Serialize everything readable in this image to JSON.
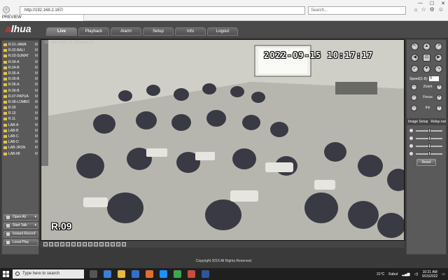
{
  "browser": {
    "url": "http://192.168.2.167/",
    "search_placeholder": "Search...",
    "tab_title": "PREVIEW"
  },
  "app": {
    "logo_prefix": "a",
    "logo_text": "lhua",
    "nav": [
      {
        "label": "Live",
        "active": true
      },
      {
        "label": "Playback",
        "active": false
      },
      {
        "label": "Alarm",
        "active": false
      },
      {
        "label": "Setup",
        "active": false
      },
      {
        "label": "Info",
        "active": false
      },
      {
        "label": "Logout",
        "active": false
      }
    ]
  },
  "cameras": [
    "R.01-JAWA",
    "R.02-BALI",
    "R.03-SUMAT",
    "R.04-A",
    "R.04-B",
    "R.05-A",
    "R.05-B",
    "R.06-A",
    "R.06-B",
    "R.07-PAPUA",
    "R.08-LOMBO",
    "R.09",
    "R.10",
    "R.11",
    "LAB-A",
    "LAB-B",
    "LAB-C",
    "LAB-D",
    "LAB-JRSN",
    "LAB-MI"
  ],
  "camera_marker": "M",
  "controls": {
    "open_all": "Open All",
    "start_talk": "Start Talk",
    "instant_record": "Instant Record",
    "local_play": "Local Play"
  },
  "video": {
    "info": "192.168.2.167_12_957Kbps_M",
    "timestamp": "2022-09-15 10:17:17",
    "label": "R.09"
  },
  "ptz": {
    "speed_label": "Speed(1-8):",
    "speed_value": "5",
    "zoom_label": "Zoom",
    "focus_label": "Focus",
    "iris_label": "Iris"
  },
  "image_setup": {
    "tab1": "Image Setup",
    "tab2": "Relay-out",
    "sliders": [
      0.5,
      0.5,
      0.5,
      0.5
    ],
    "reset_label": "Reset"
  },
  "footer": {
    "copyright": "Copyright 2015 All Rights Reserved."
  },
  "taskbar": {
    "search_placeholder": "Type here to search",
    "weather_temp": "31°C",
    "weather_text": "Kabut",
    "time": "10:21 AM",
    "date": "9/15/2022"
  }
}
